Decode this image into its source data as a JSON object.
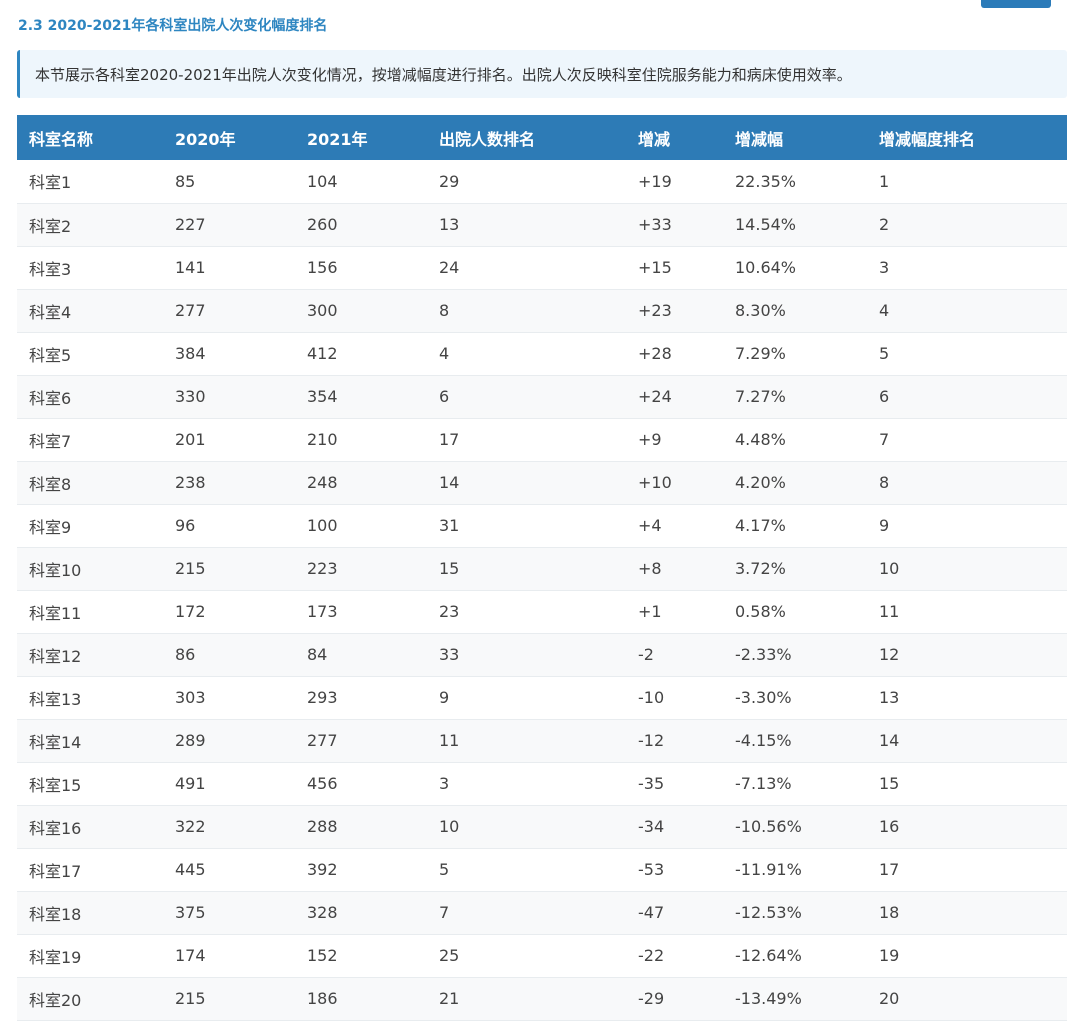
{
  "section": {
    "title": "2.3 2020-2021年各科室出院人次变化幅度排名",
    "intro": "本节展示各科室2020-2021年出院人次变化情况，按增减幅度进行排名。出院人次反映科室住院服务能力和病床使用效率。"
  },
  "colors": {
    "header_bg": "#2d7bb6",
    "title": "#2e86c1",
    "intro_bg": "#eef6fc"
  },
  "table": {
    "headers": [
      "科室名称",
      "2020年",
      "2021年",
      "出院人数排名",
      "增减",
      "增减幅",
      "增减幅度排名"
    ],
    "rows": [
      [
        "科室1",
        "85",
        "104",
        "29",
        "+19",
        "22.35%",
        "1"
      ],
      [
        "科室2",
        "227",
        "260",
        "13",
        "+33",
        "14.54%",
        "2"
      ],
      [
        "科室3",
        "141",
        "156",
        "24",
        "+15",
        "10.64%",
        "3"
      ],
      [
        "科室4",
        "277",
        "300",
        "8",
        "+23",
        "8.30%",
        "4"
      ],
      [
        "科室5",
        "384",
        "412",
        "4",
        "+28",
        "7.29%",
        "5"
      ],
      [
        "科室6",
        "330",
        "354",
        "6",
        "+24",
        "7.27%",
        "6"
      ],
      [
        "科室7",
        "201",
        "210",
        "17",
        "+9",
        "4.48%",
        "7"
      ],
      [
        "科室8",
        "238",
        "248",
        "14",
        "+10",
        "4.20%",
        "8"
      ],
      [
        "科室9",
        "96",
        "100",
        "31",
        "+4",
        "4.17%",
        "9"
      ],
      [
        "科室10",
        "215",
        "223",
        "15",
        "+8",
        "3.72%",
        "10"
      ],
      [
        "科室11",
        "172",
        "173",
        "23",
        "+1",
        "0.58%",
        "11"
      ],
      [
        "科室12",
        "86",
        "84",
        "33",
        "-2",
        "-2.33%",
        "12"
      ],
      [
        "科室13",
        "303",
        "293",
        "9",
        "-10",
        "-3.30%",
        "13"
      ],
      [
        "科室14",
        "289",
        "277",
        "11",
        "-12",
        "-4.15%",
        "14"
      ],
      [
        "科室15",
        "491",
        "456",
        "3",
        "-35",
        "-7.13%",
        "15"
      ],
      [
        "科室16",
        "322",
        "288",
        "10",
        "-34",
        "-10.56%",
        "16"
      ],
      [
        "科室17",
        "445",
        "392",
        "5",
        "-53",
        "-11.91%",
        "17"
      ],
      [
        "科室18",
        "375",
        "328",
        "7",
        "-47",
        "-12.53%",
        "18"
      ],
      [
        "科室19",
        "174",
        "152",
        "25",
        "-22",
        "-12.64%",
        "19"
      ],
      [
        "科室20",
        "215",
        "186",
        "21",
        "-29",
        "-13.49%",
        "20"
      ]
    ]
  }
}
